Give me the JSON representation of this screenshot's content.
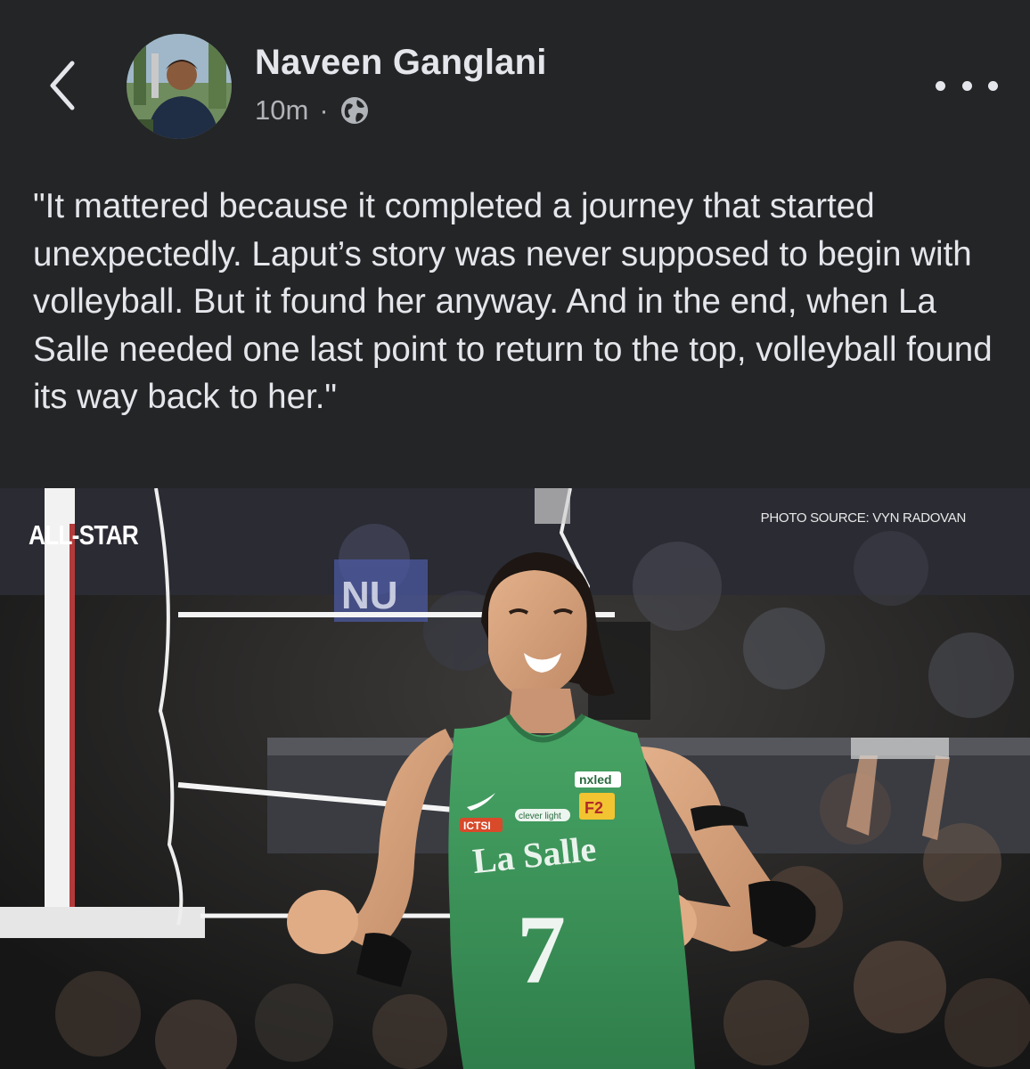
{
  "post": {
    "author": "Naveen Ganglani",
    "time": "10m",
    "separator": "·",
    "text": "\"It mattered because it completed a journey that started unexpectedly. Laput’s story was never supposed to begin with volleyball. But it found her anyway. And in the end, when La Salle needed one last point to return to the top, volleyball found its way back to her.\""
  },
  "photo": {
    "watermark": "ALL-STAR",
    "credit": "PHOTO SOURCE: VYN RADOVAN",
    "jersey_team": "La Salle",
    "jersey_number": "7",
    "sponsors": [
      "nxled",
      "F2",
      "ICTSI",
      "clever light"
    ],
    "banner_text": "NU"
  },
  "icons": {
    "back": "chevron-left-icon",
    "privacy": "globe-icon",
    "more": "more-horizontal-icon"
  },
  "colors": {
    "background": "#242526",
    "text_primary": "#e4e6eb",
    "text_secondary": "#b0b3b8",
    "jersey_green": "#3f9a5f"
  }
}
